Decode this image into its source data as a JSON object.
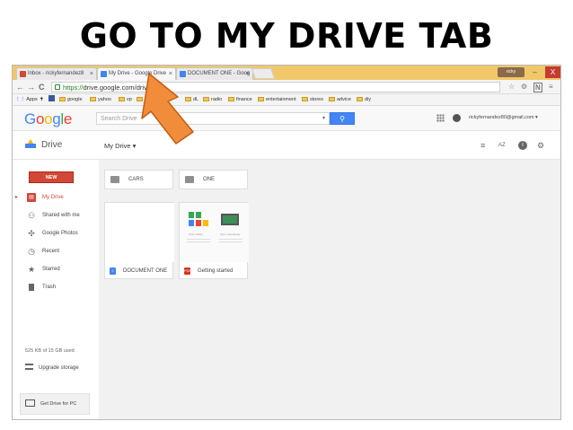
{
  "slide": {
    "title": "GO TO MY DRIVE TAB"
  },
  "browser": {
    "tabs": [
      {
        "label": "Inbox - rickyfernandez8",
        "close": "×",
        "icon_color": "#d14836"
      },
      {
        "label": "My Drive - Google Drive",
        "close": "×",
        "icon_color": "#4285f4",
        "active": true
      },
      {
        "label": "DOCUMENT ONE - Goog",
        "close": "×",
        "icon_color": "#4285f4"
      }
    ],
    "user_chip": "ricky",
    "window_controls": {
      "minimize": "–",
      "restore": "❐",
      "close": "X"
    },
    "nav": {
      "back": "←",
      "forward": "→",
      "reload": "C"
    },
    "url": {
      "scheme": "https://",
      "host": "drive.google.com",
      "path": "/drive/"
    },
    "right_icons": {
      "star": "☆",
      "ext1": "⚙",
      "ext2": "N",
      "menu": "≡"
    },
    "bookmarks": [
      {
        "label": "Apps"
      },
      {
        "label": "google"
      },
      {
        "label": "yahoo"
      },
      {
        "label": "vp"
      },
      {
        "label": "to"
      },
      {
        "label": "dL"
      },
      {
        "label": "radio"
      },
      {
        "label": "finance"
      },
      {
        "label": "entertainment"
      },
      {
        "label": "stores"
      },
      {
        "label": "advice"
      },
      {
        "label": "diy"
      }
    ]
  },
  "drive": {
    "logo": "Google",
    "search_placeholder": "Search Drive",
    "search_dropdown": "▾",
    "search_button": "🔍",
    "account_email": "rickyfernandez80@gmail.com ▾",
    "brand": "Drive",
    "my_drive_button": "My Drive ▾",
    "toolbar_icons": {
      "list": "≡",
      "sort": "AZ",
      "info": "i",
      "settings": "⚙"
    },
    "new_button": "NEW",
    "nav": [
      {
        "label": "My Drive",
        "icon": "▸",
        "active": true
      },
      {
        "label": "Shared with me",
        "icon": "👥"
      },
      {
        "label": "Google Photos",
        "icon": "✣"
      },
      {
        "label": "Recent",
        "icon": "◷"
      },
      {
        "label": "Starred",
        "icon": "★"
      },
      {
        "label": "Trash",
        "icon": "🗑"
      }
    ],
    "storage_text": "525 KB of 15 GB used",
    "upgrade_label": "Upgrade storage",
    "get_drive_label": "Get Drive for PC",
    "folders": [
      {
        "name": "CARS"
      },
      {
        "name": "ONE"
      }
    ],
    "files": [
      {
        "name": "DOCUMENT ONE",
        "type": "doc",
        "icon_color": "#4285f4"
      },
      {
        "name": "Getting started",
        "type": "pdf",
        "icon_color": "#d93025"
      }
    ],
    "getting_started_thumb": {
      "left_caption": "Store safely",
      "right_caption": "Sync seamlessly"
    }
  }
}
